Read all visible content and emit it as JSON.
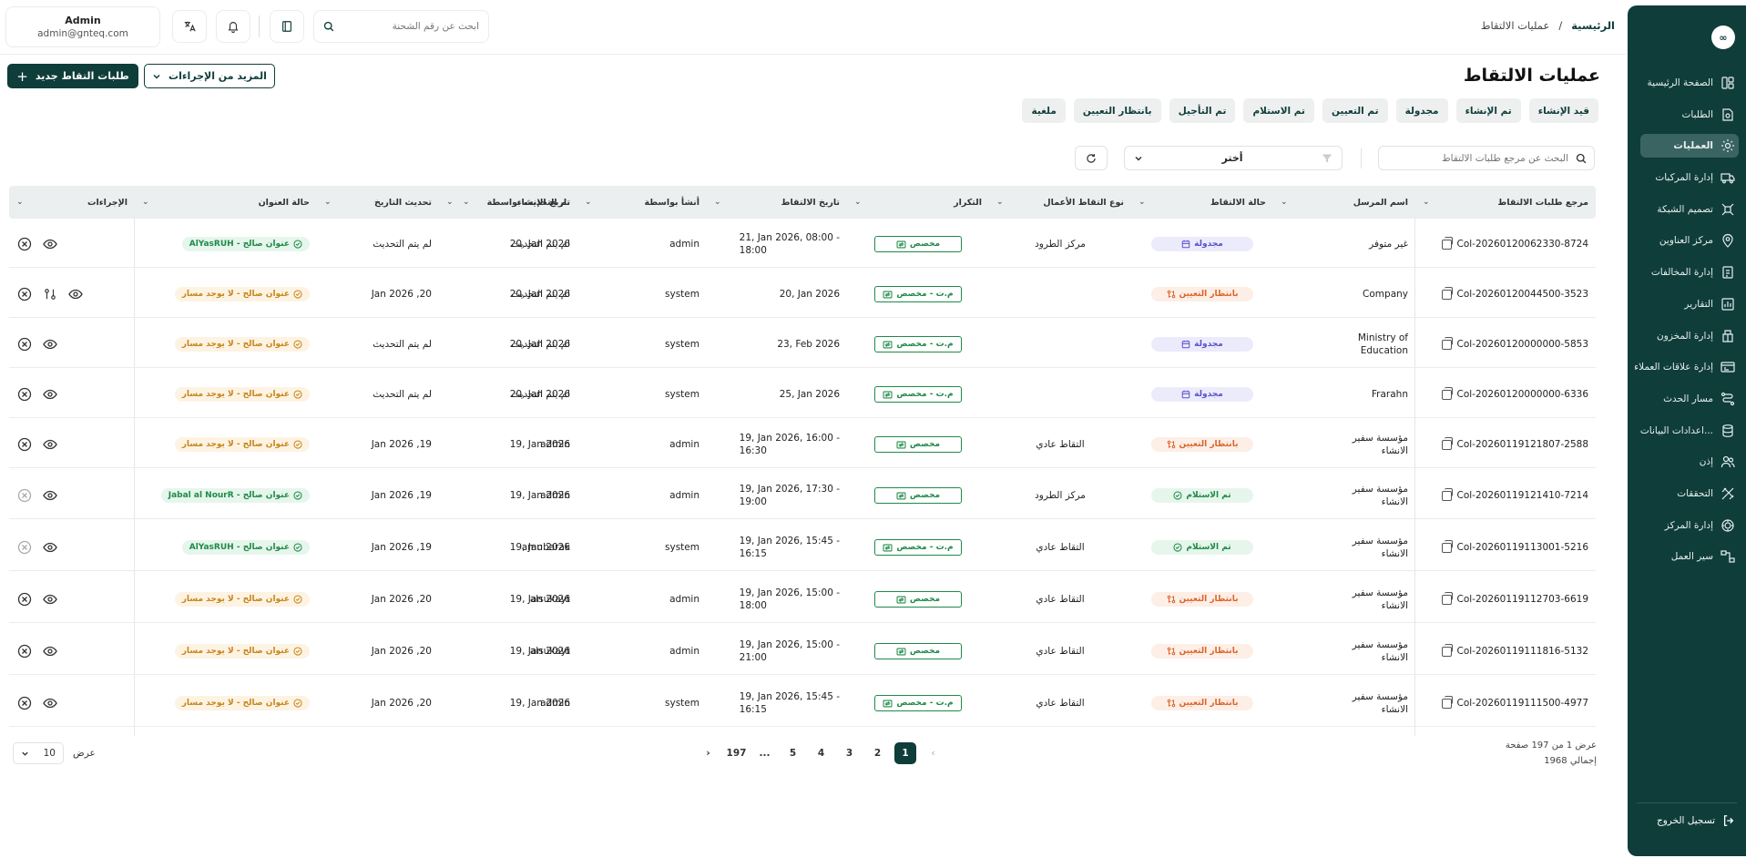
{
  "user": {
    "name": "Admin",
    "email": "admin@gnteq.com"
  },
  "topbar": {
    "search_placeholder": "ابحث عن رقم الشحنة"
  },
  "breadcrumb": {
    "home": "الرئيسية",
    "separator": "/",
    "current": "عمليات الالتقاط"
  },
  "page": {
    "title": "عمليات الالتقاط",
    "new_button": "طلبات التقاط جديد",
    "more_actions": "المزيد من الإجراءات"
  },
  "tabs": [
    "قيد الإنشاء",
    "تم الإنشاء",
    "مجدولة",
    "تم التعيين",
    "تم الاستلام",
    "تم التأجيل",
    "بانتظار التعيين",
    "ملغية"
  ],
  "filters": {
    "search_placeholder": "البحث عن مرجع طلبات الالتقاط",
    "select_label": "أختر"
  },
  "sidebar": {
    "logo": "∞",
    "items": [
      {
        "label": "الصفحة الرئيسية",
        "icon": "dashboard-icon"
      },
      {
        "label": "الطلبات",
        "icon": "orders-icon"
      },
      {
        "label": "العمليات",
        "icon": "operations-icon",
        "active": true
      },
      {
        "label": "إدارة المركبات",
        "icon": "truck-icon"
      },
      {
        "label": "تصميم الشبكة",
        "icon": "network-icon"
      },
      {
        "label": "مركز العناوين",
        "icon": "location-icon"
      },
      {
        "label": "إدارة المخالفات",
        "icon": "violations-icon"
      },
      {
        "label": "التقارير",
        "icon": "reports-icon"
      },
      {
        "label": "إدارة المخزون",
        "icon": "inventory-icon"
      },
      {
        "label": "إدارة علاقات العملاء",
        "icon": "crm-icon"
      },
      {
        "label": "مسار الحدث",
        "icon": "event-route-icon"
      },
      {
        "label": "اعدادات البيانات...",
        "icon": "database-icon"
      },
      {
        "label": "إذن",
        "icon": "permissions-icon"
      },
      {
        "label": "التحققات",
        "icon": "validations-icon"
      },
      {
        "label": "إدارة المركز",
        "icon": "center-icon"
      },
      {
        "label": "سير العمل",
        "icon": "workflow-icon"
      }
    ],
    "logout": "تسجيل الخروج"
  },
  "table": {
    "columns": [
      "مرجع طلبات الالتقاط",
      "اسم المرسل",
      "حالة الالتقاط",
      "نوع التقاط الأعمال",
      "التكرار",
      "تاريخ الالتقاط",
      "أنشأ بواسطة",
      "تاريخ الإنشاء",
      "تم التحديث بواسطة",
      "تحديث التاريخ",
      "حالة العنوان",
      "الإجراءات"
    ],
    "rows": [
      {
        "ref": "Col-20260120062330-8724",
        "sender": "غير متوفر",
        "status": "مجدولة",
        "status_kind": "scheduled",
        "type": "مركز الطرود",
        "repeat": "مخصص",
        "pickup_date_1": "21, Jan 2026, 08:00 -",
        "pickup_date_2": "18:00",
        "created_by": "admin",
        "created_date": "20, Jan 2026",
        "updated_by": "لم يتم التحديث",
        "updated_date": "لم يتم التحديث",
        "address": "عنوان صالح - AlYasRUH",
        "address_kind": "ok",
        "actions": [
          "close",
          "view"
        ]
      },
      {
        "ref": "Col-20260120044500-3523",
        "sender": "Company",
        "status": "بانتظار التعيين",
        "status_kind": "pending",
        "type": "",
        "repeat": "م.ت - مخصص",
        "pickup_date_1": "20, Jan 2026",
        "pickup_date_2": "",
        "created_by": "system",
        "created_date": "20, Jan 2026",
        "updated_by": "لم يتم التحديث",
        "updated_date": "20, Jan 2026",
        "address": "عنوان صالح - لا يوجد مسار",
        "address_kind": "warn",
        "actions": [
          "close",
          "assign",
          "view"
        ]
      },
      {
        "ref": "Col-20260120000000-5853",
        "sender": "Ministry of Education",
        "status": "مجدولة",
        "status_kind": "scheduled",
        "type": "",
        "repeat": "م.ت - مخصص",
        "pickup_date_1": "23, Feb 2026",
        "pickup_date_2": "",
        "created_by": "system",
        "created_date": "20, Jan 2026",
        "updated_by": "لم يتم التحديث",
        "updated_date": "لم يتم التحديث",
        "address": "عنوان صالح - لا يوجد مسار",
        "address_kind": "warn",
        "actions": [
          "close",
          "view"
        ]
      },
      {
        "ref": "Col-20260120000000-6336",
        "sender": "Frarahn",
        "status": "مجدولة",
        "status_kind": "scheduled",
        "type": "",
        "repeat": "م.ت - مخصص",
        "pickup_date_1": "25, Jan 2026",
        "pickup_date_2": "",
        "created_by": "system",
        "created_date": "20, Jan 2026",
        "updated_by": "لم يتم التحديث",
        "updated_date": "لم يتم التحديث",
        "address": "عنوان صالح - لا يوجد مسار",
        "address_kind": "warn",
        "actions": [
          "close",
          "view"
        ]
      },
      {
        "ref": "Col-20260119121807-2588",
        "sender": "مؤسسة سفير الانشاء",
        "status": "بانتظار التعيين",
        "status_kind": "pending",
        "type": "التقاط عادي",
        "repeat": "مخصص",
        "pickup_date_1": "19, Jan 2026, 16:00 -",
        "pickup_date_2": "16:30",
        "created_by": "admin",
        "created_date": "19, Jan 2026",
        "updated_by": "admin",
        "updated_date": "19, Jan 2026",
        "address": "عنوان صالح - لا يوجد مسار",
        "address_kind": "warn",
        "actions": [
          "close",
          "view"
        ]
      },
      {
        "ref": "Col-20260119121410-7214",
        "sender": "مؤسسة سفير الانشاء",
        "status": "تم الاستلام",
        "status_kind": "received",
        "type": "مركز الطرود",
        "repeat": "مخصص",
        "pickup_date_1": "19, Jan 2026, 17:30 -",
        "pickup_date_2": "19:00",
        "created_by": "admin",
        "created_date": "19, Jan 2026",
        "updated_by": "admin",
        "updated_date": "19, Jan 2026",
        "address": "عنوان صالح - Jabal al NourR",
        "address_kind": "ok",
        "actions": [
          "close-disabled",
          "view"
        ]
      },
      {
        "ref": "Col-20260119113001-5216",
        "sender": "مؤسسة سفير الانشاء",
        "status": "تم الاستلام",
        "status_kind": "received",
        "type": "التقاط عادي",
        "repeat": "م.ت - مخصص",
        "pickup_date_1": "19, Jan 2026, 15:45 -",
        "pickup_date_2": "16:15",
        "created_by": "system",
        "created_date": "19, Jan 2026",
        "updated_by": "amubarak",
        "updated_date": "19, Jan 2026",
        "address": "عنوان صالح - AlYasRUH",
        "address_kind": "ok",
        "actions": [
          "close-disabled",
          "view"
        ]
      },
      {
        "ref": "Col-20260119112703-6619",
        "sender": "مؤسسة سفير الانشاء",
        "status": "بانتظار التعيين",
        "status_kind": "pending",
        "type": "التقاط عادي",
        "repeat": "مخصص",
        "pickup_date_1": "19, Jan 2026, 15:00 -",
        "pickup_date_2": "18:00",
        "created_by": "admin",
        "created_date": "19, Jan 2026",
        "updated_by": "alsukayt",
        "updated_date": "20, Jan 2026",
        "address": "عنوان صالح - لا يوجد مسار",
        "address_kind": "warn",
        "actions": [
          "close",
          "view"
        ]
      },
      {
        "ref": "Col-20260119111816-5132",
        "sender": "مؤسسة سفير الانشاء",
        "status": "بانتظار التعيين",
        "status_kind": "pending",
        "type": "التقاط عادي",
        "repeat": "مخصص",
        "pickup_date_1": "19, Jan 2026, 15:00 -",
        "pickup_date_2": "21:00",
        "created_by": "admin",
        "created_date": "19, Jan 2026",
        "updated_by": "alsukayt",
        "updated_date": "20, Jan 2026",
        "address": "عنوان صالح - لا يوجد مسار",
        "address_kind": "warn",
        "actions": [
          "close",
          "view"
        ]
      },
      {
        "ref": "Col-20260119111500-4977",
        "sender": "مؤسسة سفير الانشاء",
        "status": "بانتظار التعيين",
        "status_kind": "pending",
        "type": "التقاط عادي",
        "repeat": "م.ت - مخصص",
        "pickup_date_1": "19, Jan 2026, 15:45 -",
        "pickup_date_2": "16:15",
        "created_by": "system",
        "created_date": "19, Jan 2026",
        "updated_by": "admin",
        "updated_date": "20, Jan 2026",
        "address": "عنوان صالح - لا يوجد مسار",
        "address_kind": "warn",
        "actions": [
          "close",
          "view"
        ]
      }
    ]
  },
  "pagination": {
    "prev": "‹",
    "next": "›",
    "pages": [
      "1",
      "2",
      "3",
      "4",
      "5",
      "...",
      "197"
    ],
    "current": "1",
    "info_line1": "عرض 1 من 197 صفحة",
    "info_line2": "إجمالي 1968",
    "per_page_label": "عرض",
    "per_page_value": "10"
  }
}
